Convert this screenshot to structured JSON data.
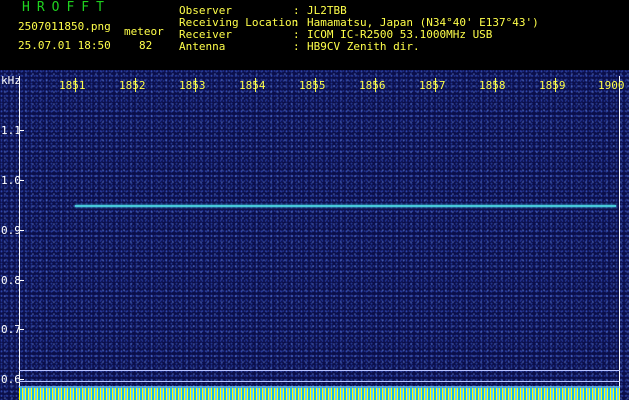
{
  "header": {
    "app_title": "HROFFT",
    "filename": "2507011850.png",
    "datetime": "25.07.01 18:50",
    "meteor_label": "meteor",
    "meteor_count": "82"
  },
  "info": [
    {
      "label": "Observer",
      "value": "JL2TBB"
    },
    {
      "label": "Receiving Location",
      "value": "Hamamatsu, Japan (N34°40' E137°43')"
    },
    {
      "label": "Receiver",
      "value": "ICOM IC-R2500 53.1000MHz USB"
    },
    {
      "label": "Antenna",
      "value": "HB9CV Zenith dir."
    }
  ],
  "plot": {
    "y_unit": "kHz",
    "x_ticks": [
      "1851",
      "1852",
      "1853",
      "1854",
      "1855",
      "1856",
      "1857",
      "1858",
      "1859",
      "1900"
    ],
    "y_ticks": [
      "1.1",
      "1.0",
      "0.9",
      "0.8",
      "0.7",
      "0.6"
    ],
    "colors": {
      "background": "#0b0f4a",
      "signal": "#46c8d8",
      "labels": "#ffff4a"
    }
  }
}
